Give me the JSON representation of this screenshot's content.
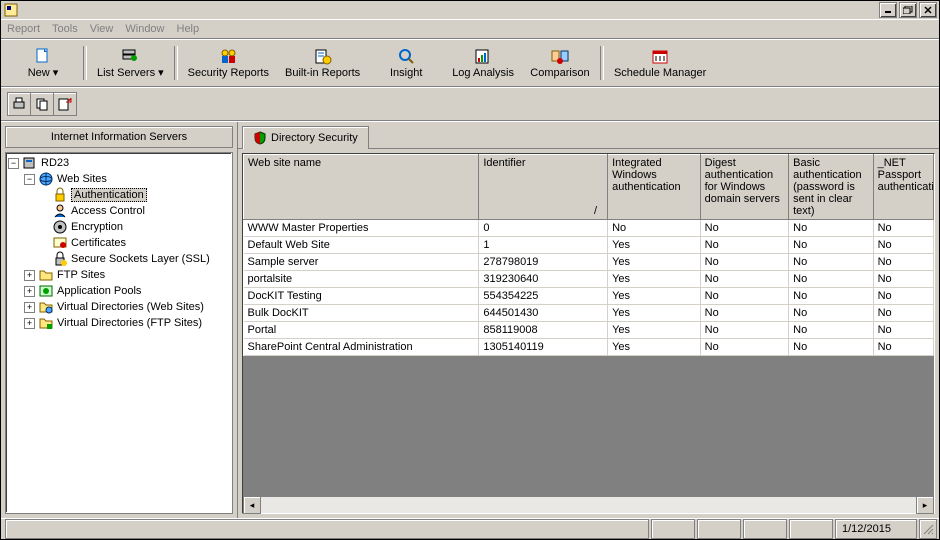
{
  "menu": {
    "report": "Report",
    "tools": "Tools",
    "view": "View",
    "window": "Window",
    "help": "Help"
  },
  "toolbar": [
    {
      "label": "New",
      "arrow": true
    },
    {
      "label": "List Servers",
      "arrow": true
    },
    {
      "label": "Security Reports"
    },
    {
      "label": "Built-in Reports"
    },
    {
      "label": "Insight"
    },
    {
      "label": "Log Analysis"
    },
    {
      "label": "Comparison"
    },
    {
      "label": "Schedule Manager"
    }
  ],
  "leftpane_title": "Internet Information Servers",
  "tree": {
    "root": "RD23",
    "websites": "Web Sites",
    "auth": "Authentication",
    "access": "Access Control",
    "enc": "Encryption",
    "cert": "Certificates",
    "ssl": "Secure Sockets Layer (SSL)",
    "ftp": "FTP Sites",
    "apppools": "Application Pools",
    "vdir_web": "Virtual Directories (Web Sites)",
    "vdir_ftp": "Virtual Directories (FTP Sites)"
  },
  "tab_label": "Directory Security",
  "columns": [
    "Web site name",
    "Identifier",
    "Integrated Windows authentication",
    "Digest authentication for Windows domain servers",
    "Basic authentication (password is sent in clear text)",
    "_NET Passport authentication"
  ],
  "rows": [
    {
      "name": "WWW Master Properties",
      "id": "0",
      "iwa": "No",
      "digest": "No",
      "basic": "No",
      "net": "No"
    },
    {
      "name": "Default Web Site",
      "id": "1",
      "iwa": "Yes",
      "digest": "No",
      "basic": "No",
      "net": "No"
    },
    {
      "name": "Sample server",
      "id": "278798019",
      "iwa": "Yes",
      "digest": "No",
      "basic": "No",
      "net": "No"
    },
    {
      "name": "portalsite",
      "id": "319230640",
      "iwa": "Yes",
      "digest": "No",
      "basic": "No",
      "net": "No"
    },
    {
      "name": "DocKIT Testing",
      "id": "554354225",
      "iwa": "Yes",
      "digest": "No",
      "basic": "No",
      "net": "No"
    },
    {
      "name": "Bulk DocKIT",
      "id": "644501430",
      "iwa": "Yes",
      "digest": "No",
      "basic": "No",
      "net": "No"
    },
    {
      "name": "Portal",
      "id": "858119008",
      "iwa": "Yes",
      "digest": "No",
      "basic": "No",
      "net": "No"
    },
    {
      "name": "SharePoint Central Administration",
      "id": "1305140119",
      "iwa": "Yes",
      "digest": "No",
      "basic": "No",
      "net": "No"
    }
  ],
  "status_date": "1/12/2015"
}
